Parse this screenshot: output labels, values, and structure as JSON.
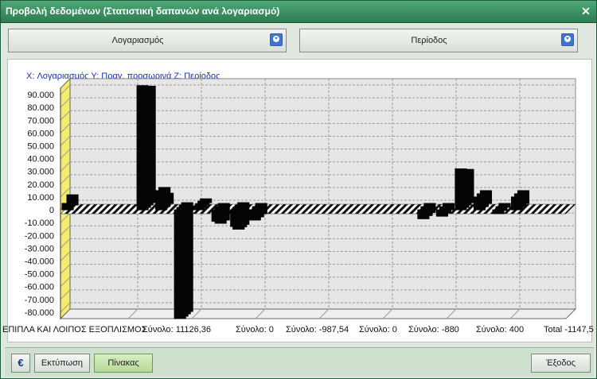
{
  "window": {
    "title": "Προβολή δεδομένων  (Στατιστική δαπανών ανά λογαριασμό)"
  },
  "selectors": {
    "account_label": "Λογαριασμός",
    "period_label": "Περίοδος"
  },
  "chart_data": {
    "type": "bar",
    "title": "X: Λογαριασμός Y: Πραγ. προσωρινά Z: Περίοδος",
    "yticks": [
      90000,
      80000,
      70000,
      60000,
      50000,
      40000,
      30000,
      20000,
      10000,
      0,
      -10000,
      -20000,
      -30000,
      -40000,
      -50000,
      -60000,
      -70000,
      -80000
    ],
    "ytick_labels": [
      "90.000",
      "80.000",
      "70.000",
      "60.000",
      "50.000",
      "40.000",
      "30.000",
      "20.000",
      "10.000",
      "0",
      "-10.000",
      "-20.000",
      "-30.000",
      "-40.000",
      "-50.000",
      "-60.000",
      "-70.000",
      "-80.000"
    ],
    "ylim": [
      -85000,
      95000
    ],
    "grid": true,
    "x_group_labels": [
      "ΕΠΙΠΛΑ ΚΑΙ ΛΟΙΠΟΣ ΕΞΟΠΛΙΣΜΟΣ",
      "Σύνολο: 11126,36",
      "Σύνολο: 0",
      "Σύνολο: -987,54",
      "Σύνολο: 0",
      "Σύνολο: -880",
      "Σύνολο: 400",
      "Total -1147,5"
    ],
    "bars": [
      {
        "x": 0,
        "values": [
          5000,
          8000
        ]
      },
      {
        "x": 4,
        "values": [
          97000,
          91000,
          91000,
          91000
        ]
      },
      {
        "x": 5,
        "values": [
          15000,
          15000,
          8000
        ]
      },
      {
        "x": 6,
        "values": [
          -85000,
          -85000,
          -85000,
          -85000
        ]
      },
      {
        "x": 7,
        "values": [
          3000,
          3000,
          3000,
          3000
        ]
      },
      {
        "x": 8,
        "values": [
          -9000,
          -13000,
          -13000
        ]
      },
      {
        "x": 9,
        "values": [
          -13000,
          -17000,
          -17000,
          -17000
        ]
      },
      {
        "x": 10,
        "values": [
          -8000,
          -8000,
          -8000
        ]
      },
      {
        "x": 19,
        "values": [
          -7000,
          -7000,
          -7000
        ]
      },
      {
        "x": 20,
        "values": [
          -5000,
          -5000,
          -5000
        ]
      },
      {
        "x": 21,
        "values": [
          32000,
          26000,
          26000,
          26000
        ]
      },
      {
        "x": 22,
        "values": [
          10000,
          10000,
          10000
        ]
      },
      {
        "x": 23,
        "values": [
          -3000,
          -3000,
          -3000
        ]
      },
      {
        "x": 24,
        "values": [
          10000,
          10000,
          10000
        ]
      }
    ]
  },
  "footer": {
    "euro_icon": "€",
    "print_label": "Εκτύπωση",
    "table_label": "Πίνακας",
    "exit_label": "Έξοδος"
  }
}
